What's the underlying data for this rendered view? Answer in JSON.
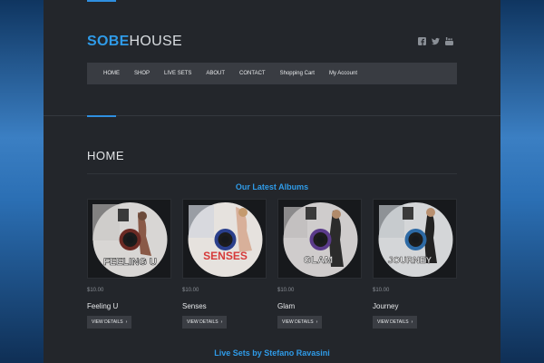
{
  "brand": {
    "bold": "SOBE",
    "light": "HOUSE"
  },
  "social": [
    "facebook-icon",
    "twitter-icon",
    "youtube-icon"
  ],
  "nav": [
    "HOME",
    "SHOP",
    "LIVE SETS",
    "ABOUT",
    "CONTACT",
    "Shopping Cart",
    "My Account"
  ],
  "page_title": "HOME",
  "albums_heading": "Our Latest Albums",
  "albums": [
    {
      "title": "Feeling U",
      "price": "$10.00",
      "button": "VIEW DETAILS",
      "cover_text": "FEELING U",
      "ring": "#6b2a24"
    },
    {
      "title": "Senses",
      "price": "$10.00",
      "button": "VIEW DETAILS",
      "cover_text": "SENSES",
      "ring": "#2a3f8c"
    },
    {
      "title": "Glam",
      "price": "$10.00",
      "button": "VIEW DETAILS",
      "cover_text": "GLAM",
      "ring": "#5a3a8a"
    },
    {
      "title": "Journey",
      "price": "$10.00",
      "button": "VIEW DETAILS",
      "cover_text": "JOURNEY",
      "ring": "#2d6aa5"
    }
  ],
  "live_sets_heading": "Live Sets by Stefano Ravasini",
  "colors": {
    "accent": "#2f9be8",
    "panel": "#23262b",
    "nav": "#393c42"
  }
}
